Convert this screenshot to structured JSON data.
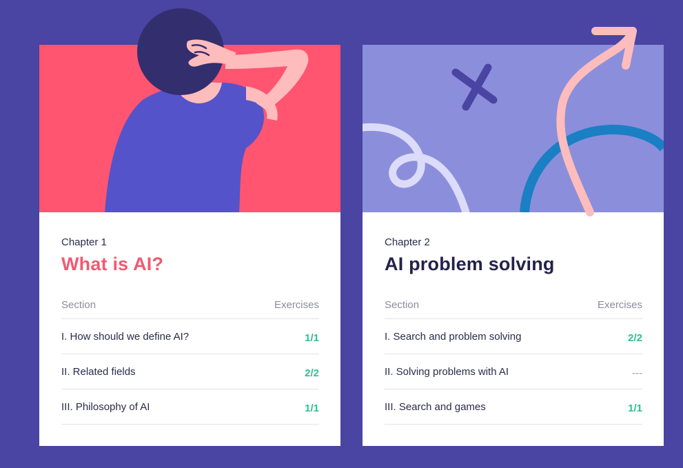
{
  "chapters": [
    {
      "label": "Chapter 1",
      "title": "What is AI?",
      "column_section": "Section",
      "column_exercises": "Exercises",
      "sections": [
        {
          "name": "I. How should we define AI?",
          "exercises": "1/1"
        },
        {
          "name": "II. Related fields",
          "exercises": "2/2"
        },
        {
          "name": "III. Philosophy of AI",
          "exercises": "1/1"
        }
      ],
      "hero_bg": "#ff5570"
    },
    {
      "label": "Chapter 2",
      "title": "AI problem solving",
      "column_section": "Section",
      "column_exercises": "Exercises",
      "sections": [
        {
          "name": "I. Search and problem solving",
          "exercises": "2/2"
        },
        {
          "name": "II. Solving problems with AI",
          "exercises": "---"
        },
        {
          "name": "III. Search and games",
          "exercises": "1/1"
        }
      ],
      "hero_bg": "#8b8fdb"
    }
  ],
  "colors": {
    "page_bg": "#4a44a3",
    "title_1": "#f25a71",
    "title_2": "#23234a",
    "done": "#2fbf8f"
  }
}
